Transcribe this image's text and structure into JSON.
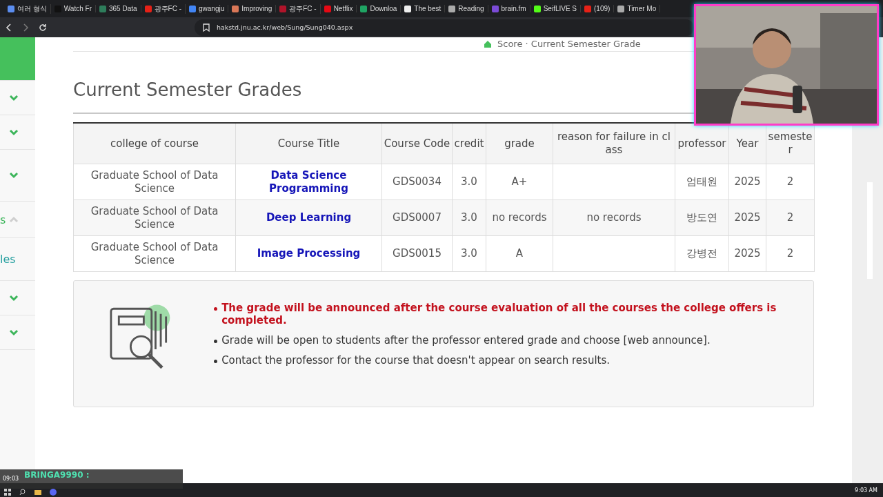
{
  "browser": {
    "tabs": [
      {
        "label": "여러 형식",
        "color": "#5b8def"
      },
      {
        "label": "Watch Fr",
        "color": "#111111"
      },
      {
        "label": "365 Data",
        "color": "#2e7d5b"
      },
      {
        "label": "광주FC -",
        "color": "#e62117"
      },
      {
        "label": "gwangju",
        "color": "#4285f4"
      },
      {
        "label": "Improving",
        "color": "#d97757"
      },
      {
        "label": "광주FC -",
        "color": "#b0142a"
      },
      {
        "label": "Netflix",
        "color": "#e50914"
      },
      {
        "label": "Downloa",
        "color": "#1fa463"
      },
      {
        "label": "The best",
        "color": "#eeeeee"
      },
      {
        "label": "Reading",
        "color": "#aaaaaa"
      },
      {
        "label": "brain.fm",
        "color": "#7b4bd6"
      },
      {
        "label": "SeifLIVE S",
        "color": "#53fc18"
      },
      {
        "label": "(109)",
        "color": "#e62117"
      },
      {
        "label": "Timer Mo",
        "color": "#aaaaaa"
      }
    ],
    "url": "hakstd.jnu.ac.kr/web/Sung/Sung040.aspx"
  },
  "sidebar": {
    "items": [
      {
        "kind": "banner"
      },
      {
        "kind": "menu",
        "expanded": false
      },
      {
        "kind": "menu",
        "expanded": false
      },
      {
        "kind": "menu",
        "expanded": false
      },
      {
        "kind": "menu",
        "label": "s",
        "expanded": true
      },
      {
        "kind": "sub",
        "label": "les"
      },
      {
        "kind": "menu",
        "expanded": false
      },
      {
        "kind": "menu",
        "expanded": false
      }
    ]
  },
  "breadcrumb": "Score · Current Semester Grade",
  "title": "Current Semester Grades",
  "table": {
    "columns": [
      "college of course",
      "Course Title",
      "Course Code",
      "credit",
      "grade",
      "reason for failure in class",
      "professor",
      "Year",
      "semester"
    ],
    "rows": [
      [
        "Graduate School of Data Science",
        "Data Science Programming",
        "GDS0034",
        "3.0",
        "A+",
        "",
        "엄태원",
        "2025",
        "2"
      ],
      [
        "Graduate School of Data Science",
        "Deep Learning",
        "GDS0007",
        "3.0",
        "no records",
        "no records",
        "방도연",
        "2025",
        "2"
      ],
      [
        "Graduate School of Data Science",
        "Image Processing",
        "GDS0015",
        "3.0",
        "A",
        "",
        "강병전",
        "2025",
        "2"
      ]
    ]
  },
  "notices": [
    {
      "text": "The grade will be announced after the course evaluation of all the courses the college offers is completed.",
      "important": true
    },
    {
      "text": "Grade will be open to students after the professor entered grade and choose [web announce].",
      "important": false
    },
    {
      "text": "Contact the professor for the course that doesn't appear on search results.",
      "important": false
    }
  ],
  "stream_overlay": {
    "time": "09:03",
    "name": "BRINGA9990 :"
  },
  "taskbar": {
    "clock": "9:03 AM"
  }
}
